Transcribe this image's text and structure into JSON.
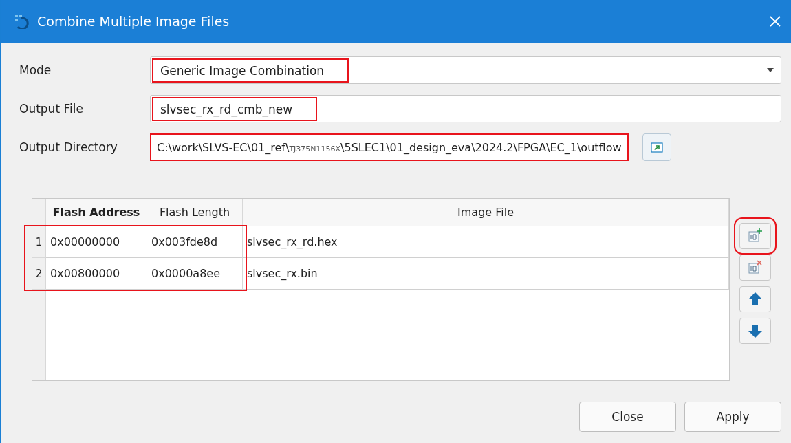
{
  "window": {
    "title": "Combine Multiple Image Files"
  },
  "form": {
    "mode": {
      "label": "Mode",
      "value": "Generic Image Combination",
      "highlighted": true
    },
    "output_file": {
      "label": "Output File",
      "value": "slvsec_rx_rd_cmb_new",
      "highlighted": true
    },
    "output_directory": {
      "label": "Output Directory",
      "value_parts": [
        "C:\\work\\SLVS-EC\\01_ref\\",
        "TJ375N1156X",
        "\\5SLEC1\\01_design_eva\\2024.2\\FPGA\\EC_1\\outflow"
      ],
      "highlighted": true
    }
  },
  "table": {
    "columns": [
      {
        "label": "Flash Address",
        "bold": true
      },
      {
        "label": "Flash Length",
        "bold": false
      },
      {
        "label": "Image File",
        "bold": false
      }
    ],
    "rows": [
      {
        "number": "1",
        "cells": [
          "0x00000000",
          "0x003fde8d",
          "slvsec_rx_rd.hex"
        ]
      },
      {
        "number": "2",
        "cells": [
          "0x00800000",
          "0x0000a8ee",
          "slvsec_rx.bin"
        ]
      }
    ],
    "rows_highlighted": true
  },
  "side_buttons": [
    {
      "kind": "add",
      "highlighted": true
    },
    {
      "kind": "remove",
      "highlighted": false
    },
    {
      "kind": "up",
      "highlighted": false
    },
    {
      "kind": "down",
      "highlighted": false
    }
  ],
  "buttons": [
    "Close",
    "Apply"
  ]
}
